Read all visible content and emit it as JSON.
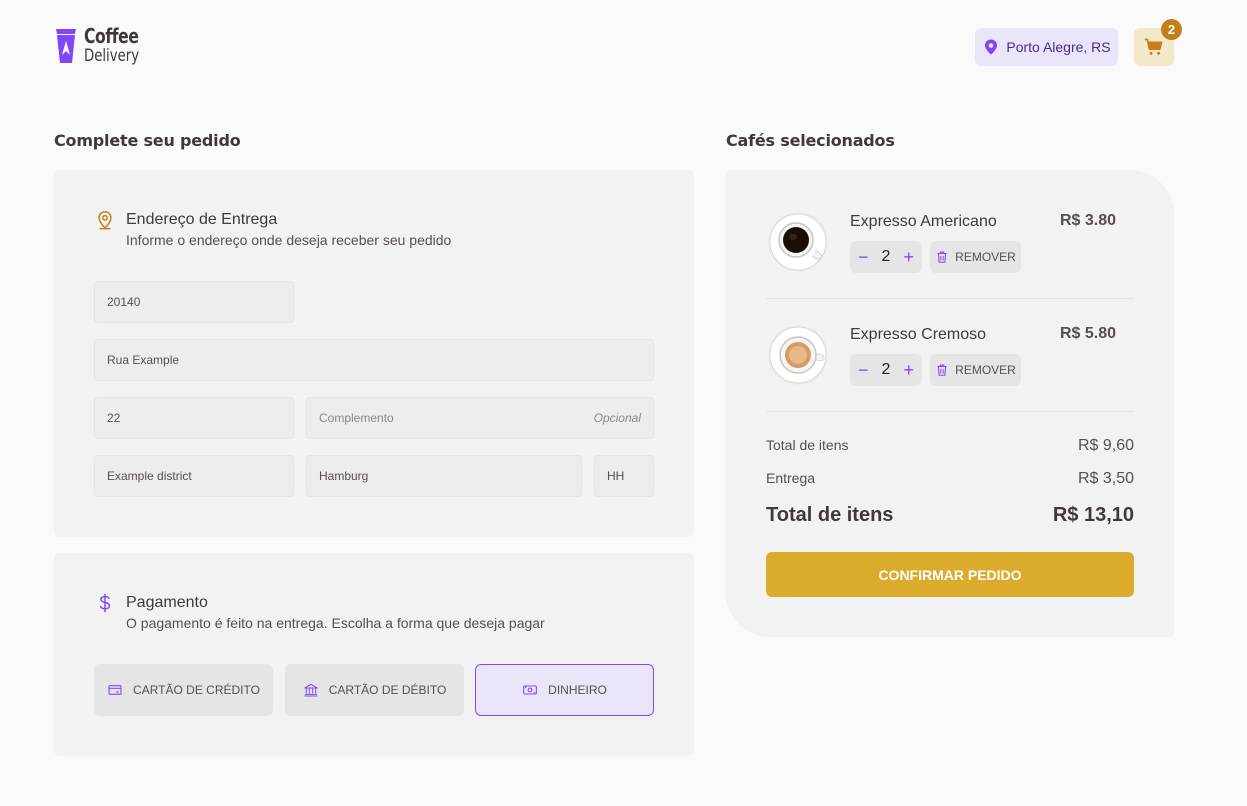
{
  "header": {
    "logo_line1": "Coffee",
    "logo_line2": "Delivery",
    "location": "Porto Alegre, RS",
    "cart_count": "2",
    "icons": {
      "logo": "coffee-cup-logo-icon",
      "location": "map-pin-icon",
      "cart": "shopping-cart-icon"
    }
  },
  "checkout": {
    "title": "Complete seu pedido",
    "address": {
      "heading": "Endereço de Entrega",
      "subheading": "Informe o endereço onde deseja receber seu pedido",
      "cep": "20140",
      "street": "Rua Example",
      "number": "22",
      "complement_placeholder": "Complemento",
      "complement_optional": "Opcional",
      "district": "Example district",
      "city": "Hamburg",
      "uf": "HH"
    },
    "payment": {
      "heading": "Pagamento",
      "subheading": "O pagamento é feito na entrega. Escolha a forma que deseja pagar",
      "options": [
        {
          "label": "CARTÃO DE CRÉDITO",
          "icon": "credit-card-icon",
          "selected": false
        },
        {
          "label": "CARTÃO DE DÉBITO",
          "icon": "bank-icon",
          "selected": false
        },
        {
          "label": "DINHEIRO",
          "icon": "money-icon",
          "selected": true
        }
      ]
    }
  },
  "cart": {
    "title": "Cafés selecionados",
    "items": [
      {
        "name": "Expresso Americano",
        "price": "R$ 3.80",
        "qty": "2",
        "remove_label": "REMOVER"
      },
      {
        "name": "Expresso Cremoso",
        "price": "R$ 5.80",
        "qty": "2",
        "remove_label": "REMOVER"
      }
    ],
    "summary": {
      "items_label": "Total de itens",
      "items_value": "R$ 9,60",
      "delivery_label": "Entrega",
      "delivery_value": "R$ 3,50",
      "total_label": "Total de itens",
      "total_value": "R$ 13,10"
    },
    "confirm_label": "CONFIRMAR PEDIDO"
  },
  "colors": {
    "purple": "#8047F8",
    "purple_dark": "#4B2995",
    "yellow": "#DBAC2C",
    "yellow_dark": "#C47F17",
    "base_card": "#F3F2F2"
  }
}
